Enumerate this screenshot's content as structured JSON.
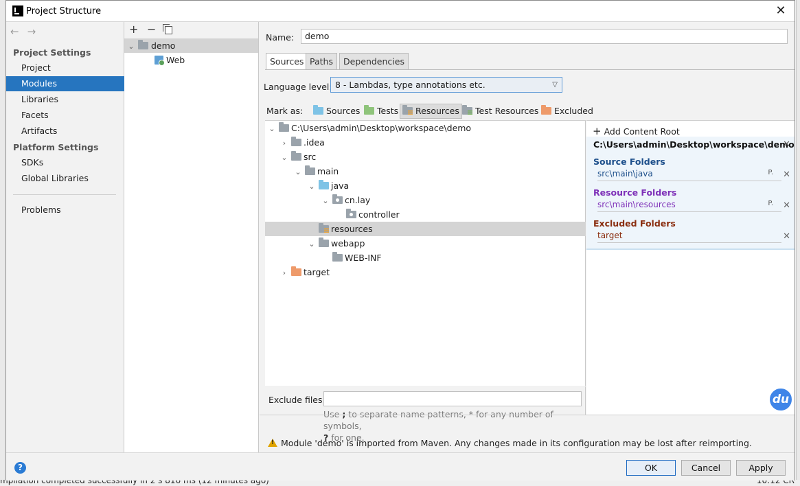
{
  "window": {
    "title": "Project Structure"
  },
  "sidebar": {
    "project_settings_header": "Project Settings",
    "project_items": [
      "Project",
      "Modules",
      "Libraries",
      "Facets",
      "Artifacts"
    ],
    "platform_settings_header": "Platform Settings",
    "platform_items": [
      "SDKs",
      "Global Libraries"
    ],
    "problems": "Problems",
    "selected": "Modules"
  },
  "modules": {
    "toolbar": {
      "add": "+",
      "remove": "−"
    },
    "items": [
      {
        "label": "demo",
        "selected": true
      },
      {
        "label": "Web",
        "selected": false
      }
    ]
  },
  "main": {
    "name_label": "Name:",
    "name_value": "demo",
    "tabs": [
      "Sources",
      "Paths",
      "Dependencies"
    ],
    "active_tab": "Sources",
    "language_level_label": "Language level:",
    "language_level_value": "8 - Lambdas, type annotations etc.",
    "mark_as_label": "Mark as:",
    "mark_as_buttons": [
      "Sources",
      "Tests",
      "Resources",
      "Test Resources",
      "Excluded"
    ],
    "tree": [
      {
        "label": "C:\\Users\\admin\\Desktop\\workspace\\demo",
        "expanded": true
      },
      {
        "label": ".idea",
        "expanded": false
      },
      {
        "label": "src",
        "expanded": true
      },
      {
        "label": "main",
        "expanded": true
      },
      {
        "label": "java",
        "expanded": true
      },
      {
        "label": "cn.lay",
        "expanded": true
      },
      {
        "label": "controller"
      },
      {
        "label": "resources",
        "selected": true
      },
      {
        "label": "webapp",
        "expanded": true
      },
      {
        "label": "WEB-INF"
      },
      {
        "label": "target",
        "expanded": false
      }
    ],
    "exclude_files_label": "Exclude files:",
    "exclude_files_value": "",
    "hint_part1": "Use ",
    "hint_sep": ";",
    "hint_part2": " to separate name patterns, * for any number of symbols,",
    "hint_q": "?",
    "hint_part3": " for one.",
    "warning": "Module 'demo' is imported from Maven. Any changes made in its configuration may be lost after reimporting."
  },
  "roots": {
    "add_content_root": "Add Content Root",
    "root_path": "C:\\Users\\admin\\Desktop\\workspace\\demo",
    "source_folders_title": "Source Folders",
    "source_folders": [
      "src\\main\\java"
    ],
    "resource_folders_title": "Resource Folders",
    "resource_folders": [
      "src\\main\\resources"
    ],
    "excluded_folders_title": "Excluded Folders",
    "excluded_folders": [
      "target"
    ],
    "properties_glyph": "P.",
    "colors": {
      "source": "#1d4f8b",
      "resource": "#7e30b8",
      "excluded": "#8a2e10"
    }
  },
  "buttons": {
    "ok": "OK",
    "cancel": "Cancel",
    "apply": "Apply"
  },
  "background": {
    "status_text": "mpilation completed successfully in 2 s 816 ms (12 minutes ago)",
    "time": "10:12   CR"
  },
  "overlay": {
    "badge": "du"
  }
}
